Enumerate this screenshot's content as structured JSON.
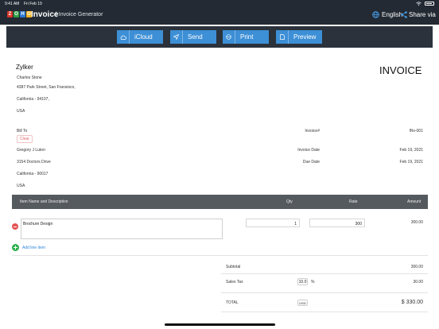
{
  "status": {
    "time": "9:41 AM",
    "date": "Fri Feb 19"
  },
  "app": {
    "logo": [
      "Z",
      "O",
      "H",
      "O"
    ],
    "brand": "Invoice",
    "subtitle": "| Invoice Generator",
    "language": "English",
    "share": "Share via"
  },
  "toolbar": {
    "icloud": "iCloud",
    "send": "Send",
    "print": "Print",
    "preview": "Preview"
  },
  "doc_title": "INVOICE",
  "company": {
    "name": "Zylker",
    "person": "Charles Stone",
    "street": "4387 Park Street, San Fransisco,",
    "city": "California - 94107,",
    "country": "USA"
  },
  "bill_to": {
    "label": "Bill To",
    "clear": "Clear",
    "name": "Gregory J Luton",
    "street": "3154 Doctors Drive",
    "city": "California - 90017",
    "country": "USA"
  },
  "meta": {
    "invoice_no_label": "Invoice#",
    "invoice_no": "INv-001",
    "invoice_date_label": "Invoice Date",
    "invoice_date": "Feb 19, 2021",
    "due_date_label": "Due Date",
    "due_date": "Feb 19, 2021"
  },
  "table": {
    "headers": {
      "item": "Item Name and Description",
      "qty": "Qty",
      "rate": "Rate",
      "amount": "Amount"
    },
    "rows": [
      {
        "description": "Brochure Design",
        "qty": "1",
        "rate": "300",
        "amount": "300.00"
      }
    ],
    "add_line": "Add line item"
  },
  "totals": {
    "subtotal_label": "Subtotal",
    "subtotal": "300.00",
    "tax_label": "Sales Tax",
    "tax_rate": "10.0",
    "tax_unit": "%",
    "tax": "30.00",
    "total_label": "TOTAL",
    "currency": "USD",
    "total": "$ 330.00"
  },
  "colors": {
    "appbar": "#232a33",
    "button": "#3d8fd6",
    "table_header": "#555a5f",
    "remove": "#e45252",
    "add": "#2bb14c"
  }
}
